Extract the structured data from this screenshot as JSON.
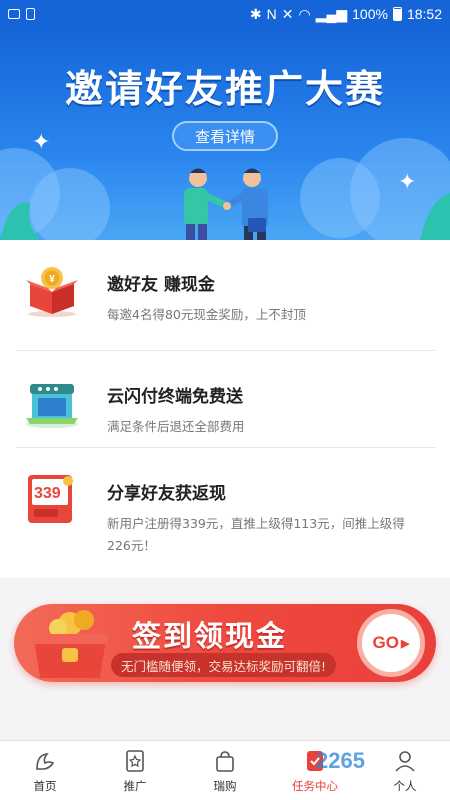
{
  "status_bar": {
    "battery": "100%",
    "time": "18:52"
  },
  "banner": {
    "title": "邀请好友推广大赛",
    "detail_button": "查看详情"
  },
  "items": [
    {
      "title": "邀好友 赚现金",
      "desc": "每邀4名得80元现金奖励，上不封顶",
      "icon": "gift-box-icon"
    },
    {
      "title": "云闪付终端免费送",
      "desc": "满足条件后退还全部费用",
      "icon": "pos-terminal-icon"
    },
    {
      "title": "分享好友获返现",
      "desc": "新用户注册得339元，直推上级得113元，间推上级得226元！",
      "icon": "red-packet-339-icon",
      "badge": "339"
    }
  ],
  "sign_banner": {
    "title": "签到领现金",
    "subtitle": "无门槛随便领，交易达标奖励可翻倍!",
    "go_button": "GO"
  },
  "tabs": [
    {
      "label": "首页",
      "icon": "home-icon"
    },
    {
      "label": "推广",
      "icon": "star-doc-icon"
    },
    {
      "label": "瑞购",
      "icon": "shopping-bag-icon"
    },
    {
      "label": "任务中心",
      "icon": "task-icon",
      "active": true
    },
    {
      "label": "个人",
      "icon": "person-icon"
    }
  ],
  "watermark": "2265",
  "colors": {
    "primary_blue": "#1565d8",
    "accent_red": "#e9403c"
  }
}
